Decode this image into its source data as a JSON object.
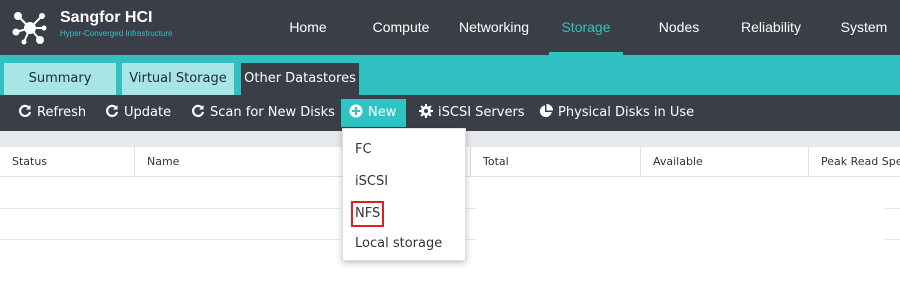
{
  "app": {
    "title": "Sangfor HCI",
    "subtitle": "Hyper-Converged Infrastructure",
    "accent_color": "#2ec4c4",
    "logo_icon": "network-nodes-icon"
  },
  "nav": {
    "items": [
      {
        "label": "Home"
      },
      {
        "label": "Compute"
      },
      {
        "label": "Networking"
      },
      {
        "label": "Storage",
        "active": true
      },
      {
        "label": "Nodes"
      },
      {
        "label": "Reliability"
      },
      {
        "label": "System"
      }
    ]
  },
  "tabs": [
    {
      "label": "Summary"
    },
    {
      "label": "Virtual Storage"
    },
    {
      "label": "Other Datastores",
      "active": true
    }
  ],
  "toolbar": {
    "refresh": {
      "label": "Refresh",
      "icon": "refresh-icon"
    },
    "update": {
      "label": "Update",
      "icon": "refresh-icon"
    },
    "scan": {
      "label": "Scan for New Disks",
      "icon": "refresh-icon"
    },
    "new": {
      "label": "New",
      "icon": "plus-circle-icon"
    },
    "iscsi": {
      "label": "iSCSI Servers",
      "icon": "gear-icon"
    },
    "disks": {
      "label": "Physical Disks in Use",
      "icon": "pie-chart-icon"
    }
  },
  "table": {
    "columns": [
      "Status",
      "Name",
      "Total",
      "Available",
      "Peak Read Speed"
    ]
  },
  "dropdown": {
    "items": [
      {
        "label": "FC"
      },
      {
        "label": "iSCSI"
      },
      {
        "label": "NFS",
        "highlighted": true
      },
      {
        "label": "Local storage"
      }
    ]
  }
}
